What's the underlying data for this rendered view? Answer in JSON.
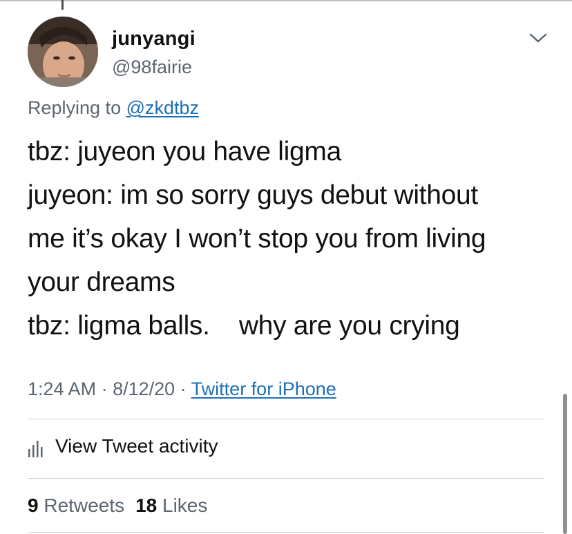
{
  "user": {
    "display_name": "junyangi",
    "handle": "@98fairie",
    "avatar_icon": "profile-photo"
  },
  "reply": {
    "prefix": "Replying to ",
    "mention": "@zkdtbz"
  },
  "tweet": {
    "lines": [
      "tbz: juyeon you have ligma",
      "juyeon: im so sorry guys debut without",
      "me it’s okay I won’t stop you from living",
      "your dreams",
      "tbz: ligma balls.    why are you crying"
    ]
  },
  "meta": {
    "time": "1:24 AM",
    "separator1": " · ",
    "date": "8/12/20",
    "separator2": " · ",
    "source": "Twitter for iPhone"
  },
  "activity": {
    "label": "View Tweet activity",
    "icon": "bar-chart-icon"
  },
  "stats": {
    "retweets_count": "9",
    "retweets_label": "Retweets",
    "likes_count": "18",
    "likes_label": "Likes"
  },
  "colors": {
    "link": "#1d6fb8",
    "secondary_text": "#5b6670",
    "primary_text": "#111111",
    "divider": "#cfd5da"
  }
}
